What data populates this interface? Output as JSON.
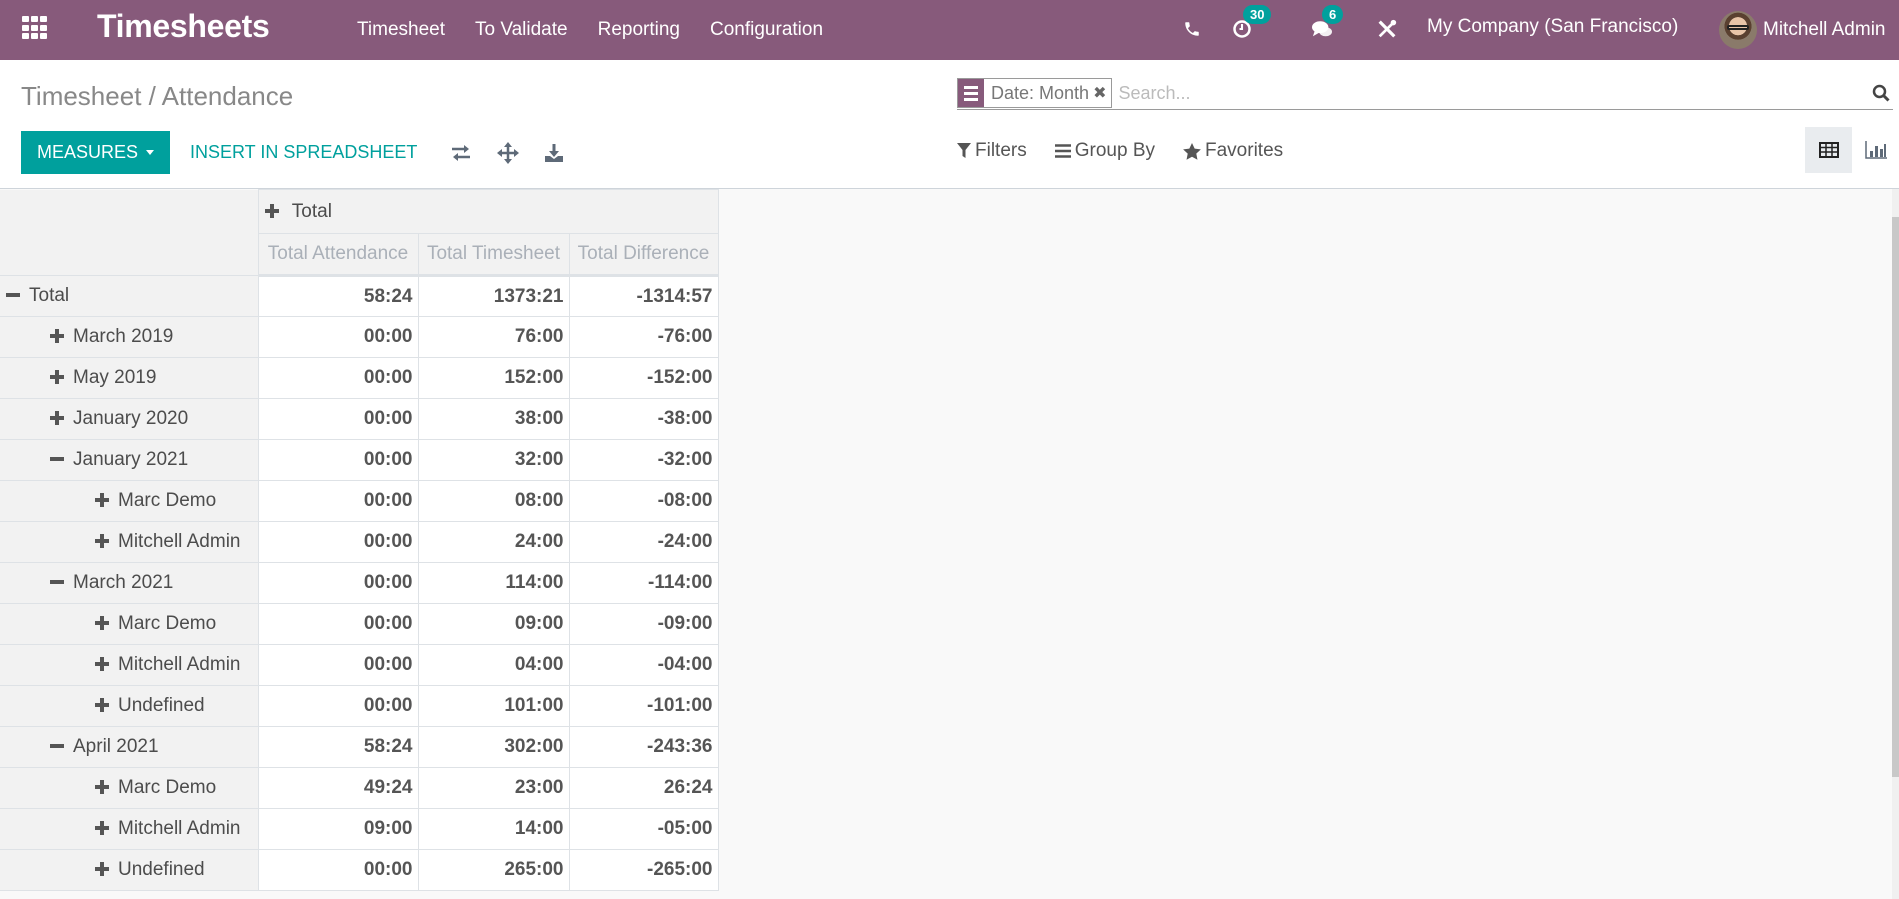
{
  "navbar": {
    "app_title": "Timesheets",
    "menu": [
      "Timesheet",
      "To Validate",
      "Reporting",
      "Configuration"
    ],
    "activity_badge": "30",
    "messages_badge": "6",
    "company": "My Company (San Francisco)",
    "user": "Mitchell Admin",
    "brand_color": "#875a7b"
  },
  "control_panel": {
    "breadcrumb": "Timesheet / Attendance",
    "measures_label": "Measures",
    "insert_label": "Insert in Spreadsheet",
    "tools": [
      "flip-axis-icon",
      "expand-all-icon",
      "download-icon"
    ],
    "search": {
      "facet_label": "Date: Month",
      "placeholder": "Search..."
    },
    "filters_label": "Filters",
    "groupby_label": "Group By",
    "favorites_label": "Favorites",
    "views": [
      "pivot",
      "graph"
    ],
    "active_view": "pivot",
    "accent_color": "#00a09d"
  },
  "pivot": {
    "col_group_label": "Total",
    "measures": [
      "Total Attendance",
      "Total Timesheet",
      "Total Difference"
    ],
    "rows": [
      {
        "label": "Total",
        "level": 0,
        "expanded": true,
        "values": [
          "58:24",
          "1373:21",
          "-1314:57"
        ]
      },
      {
        "label": "March 2019",
        "level": 1,
        "expanded": false,
        "values": [
          "00:00",
          "76:00",
          "-76:00"
        ]
      },
      {
        "label": "May 2019",
        "level": 1,
        "expanded": false,
        "values": [
          "00:00",
          "152:00",
          "-152:00"
        ]
      },
      {
        "label": "January 2020",
        "level": 1,
        "expanded": false,
        "values": [
          "00:00",
          "38:00",
          "-38:00"
        ]
      },
      {
        "label": "January 2021",
        "level": 1,
        "expanded": true,
        "values": [
          "00:00",
          "32:00",
          "-32:00"
        ]
      },
      {
        "label": "Marc Demo",
        "level": 2,
        "expanded": false,
        "values": [
          "00:00",
          "08:00",
          "-08:00"
        ]
      },
      {
        "label": "Mitchell Admin",
        "level": 2,
        "expanded": false,
        "values": [
          "00:00",
          "24:00",
          "-24:00"
        ]
      },
      {
        "label": "March 2021",
        "level": 1,
        "expanded": true,
        "values": [
          "00:00",
          "114:00",
          "-114:00"
        ]
      },
      {
        "label": "Marc Demo",
        "level": 2,
        "expanded": false,
        "values": [
          "00:00",
          "09:00",
          "-09:00"
        ]
      },
      {
        "label": "Mitchell Admin",
        "level": 2,
        "expanded": false,
        "values": [
          "00:00",
          "04:00",
          "-04:00"
        ]
      },
      {
        "label": "Undefined",
        "level": 2,
        "expanded": false,
        "values": [
          "00:00",
          "101:00",
          "-101:00"
        ]
      },
      {
        "label": "April 2021",
        "level": 1,
        "expanded": true,
        "values": [
          "58:24",
          "302:00",
          "-243:36"
        ]
      },
      {
        "label": "Marc Demo",
        "level": 2,
        "expanded": false,
        "values": [
          "49:24",
          "23:00",
          "26:24"
        ]
      },
      {
        "label": "Mitchell Admin",
        "level": 2,
        "expanded": false,
        "values": [
          "09:00",
          "14:00",
          "-05:00"
        ]
      },
      {
        "label": "Undefined",
        "level": 2,
        "expanded": false,
        "values": [
          "00:00",
          "265:00",
          "-265:00"
        ]
      }
    ]
  }
}
